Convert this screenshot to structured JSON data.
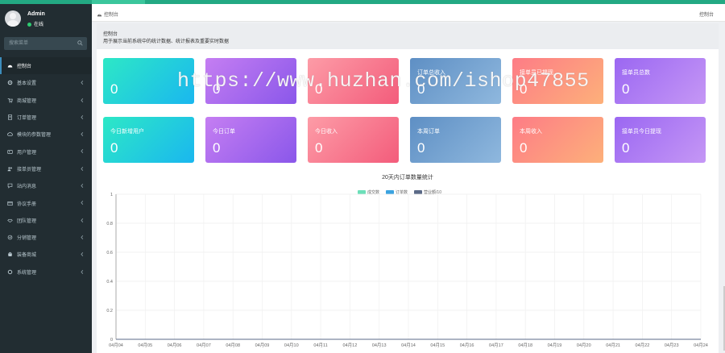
{
  "user": {
    "name": "Admin",
    "status": "在线"
  },
  "sidebar": {
    "search_placeholder": "搜索菜单",
    "items": [
      {
        "label": "控制台",
        "icon": "dashboard-icon"
      },
      {
        "label": "基本设置",
        "icon": "gear-icon"
      },
      {
        "label": "商城管理",
        "icon": "cart-icon"
      },
      {
        "label": "订单管理",
        "icon": "order-icon"
      },
      {
        "label": "模块的参数管理",
        "icon": "cloud-icon"
      },
      {
        "label": "用户管理",
        "icon": "user-icon"
      },
      {
        "label": "接单员管理",
        "icon": "users-icon"
      },
      {
        "label": "站内消息",
        "icon": "message-icon"
      },
      {
        "label": "协议手册",
        "icon": "book-icon"
      },
      {
        "label": "团队管理",
        "icon": "handshake-icon"
      },
      {
        "label": "分销管理",
        "icon": "share-icon"
      },
      {
        "label": "装备商城",
        "icon": "shop-icon"
      },
      {
        "label": "系统管理",
        "icon": "cog-icon"
      }
    ]
  },
  "breadcrumb": {
    "home": "控制台",
    "right": "控制台"
  },
  "intro": {
    "title": "控制台",
    "desc": "用于展示当前系统中的统计数据、统计报表及重要实时数据"
  },
  "cards_row1": [
    {
      "label": "",
      "value": "0"
    },
    {
      "label": "",
      "value": "0"
    },
    {
      "label": "",
      "value": "0"
    },
    {
      "label": "订单总收入",
      "value": "0"
    },
    {
      "label": "接单员已提现",
      "value": "0"
    },
    {
      "label": "接单员总数",
      "value": "0"
    }
  ],
  "cards_row2": [
    {
      "label": "今日新增用户",
      "value": "0"
    },
    {
      "label": "今日订单",
      "value": "0"
    },
    {
      "label": "今日收入",
      "value": "0"
    },
    {
      "label": "本周订单",
      "value": "0"
    },
    {
      "label": "本周收入",
      "value": "0"
    },
    {
      "label": "接单员今日提现",
      "value": "0"
    }
  ],
  "watermark": "https://www.huzhan.com/ishop47855",
  "colors": {
    "accent": "#23a983",
    "sidebar": "#222d32"
  },
  "chart_data": {
    "type": "line",
    "title": "20天内订单数量统计",
    "x": [
      "04月04",
      "04月05",
      "04月06",
      "04月07",
      "04月08",
      "04月09",
      "04月10",
      "04月11",
      "04月12",
      "04月13",
      "04月14",
      "04月15",
      "04月16",
      "04月17",
      "04月18",
      "04月19",
      "04月20",
      "04月21",
      "04月22",
      "04月23",
      "04月24"
    ],
    "yticks": [
      "0",
      "0.2",
      "0.4",
      "0.6",
      "0.8",
      "1"
    ],
    "ylim": [
      0,
      1
    ],
    "grid": true,
    "legend_position": "top",
    "series": [
      {
        "name": "成交数",
        "color": "#6cdfb9",
        "values": [
          0,
          0,
          0,
          0,
          0,
          0,
          0,
          0,
          0,
          0,
          0,
          0,
          0,
          0,
          0,
          0,
          0,
          0,
          0,
          0,
          0
        ]
      },
      {
        "name": "订单数",
        "color": "#3ba3e0",
        "values": [
          0,
          0,
          0,
          0,
          0,
          0,
          0,
          0,
          0,
          0,
          0,
          0,
          0,
          0,
          0,
          0,
          0,
          0,
          0,
          0,
          0
        ]
      },
      {
        "name": "营业额/10",
        "color": "#5b6a87",
        "values": [
          0,
          0,
          0,
          0,
          0,
          0,
          0,
          0,
          0,
          0,
          0,
          0,
          0,
          0,
          0,
          0,
          0,
          0,
          0,
          0,
          0
        ]
      }
    ]
  }
}
